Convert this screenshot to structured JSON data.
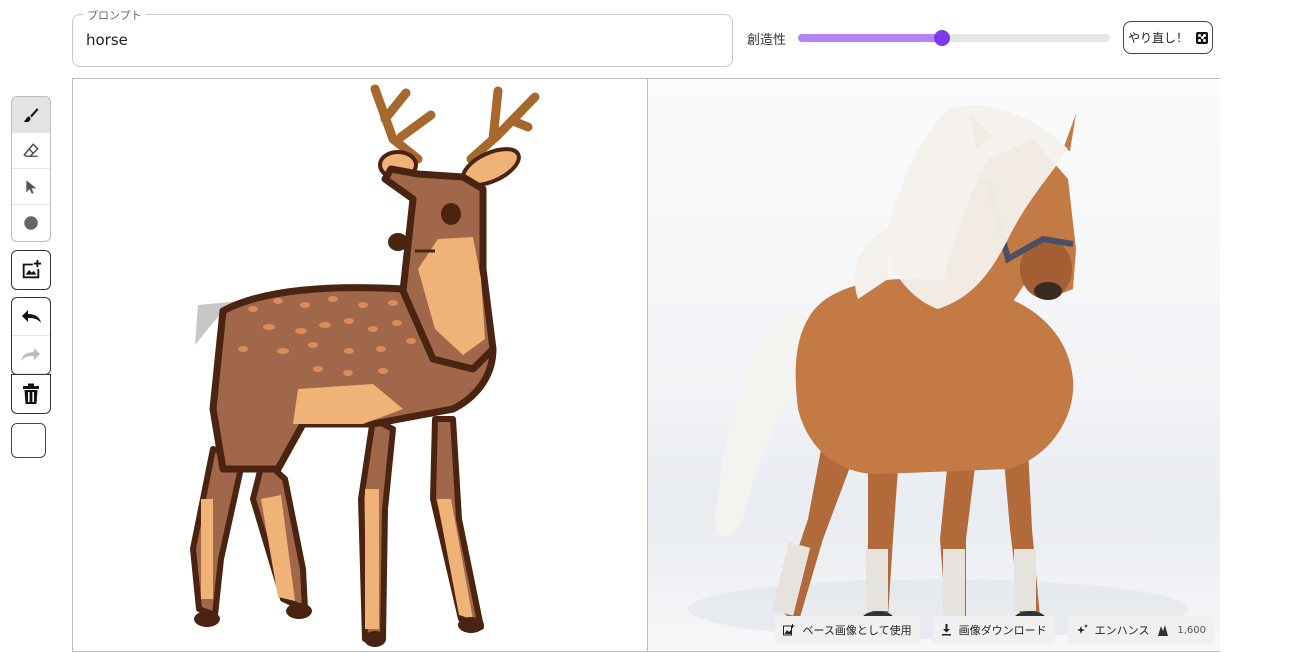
{
  "prompt": {
    "legend": "プロンプト",
    "value": "horse"
  },
  "creativity": {
    "label": "創造性",
    "value": 0.46
  },
  "redo_button": {
    "label": "やり直し！"
  },
  "toolbar": {
    "tools": [
      {
        "name": "brush-icon",
        "active": true
      },
      {
        "name": "eraser-icon",
        "active": false
      },
      {
        "name": "pointer-icon",
        "active": false
      },
      {
        "name": "circle-icon",
        "active": false
      }
    ],
    "icons": [
      "add-image-icon",
      "undo-icon",
      "redo-icon",
      "trash-icon"
    ]
  },
  "actions": {
    "use_as_base": "ベース画像として使用",
    "download": "画像ダウンロード",
    "enhance": "エンハンス",
    "credits": "1,600"
  },
  "colors": {
    "accent": "#7c3aed",
    "accent_light": "#b782f7",
    "deer_body": "#a0674a",
    "deer_light": "#efb277",
    "outline": "#4a2410",
    "antler": "#a7682e",
    "horse": "#c37a44"
  }
}
